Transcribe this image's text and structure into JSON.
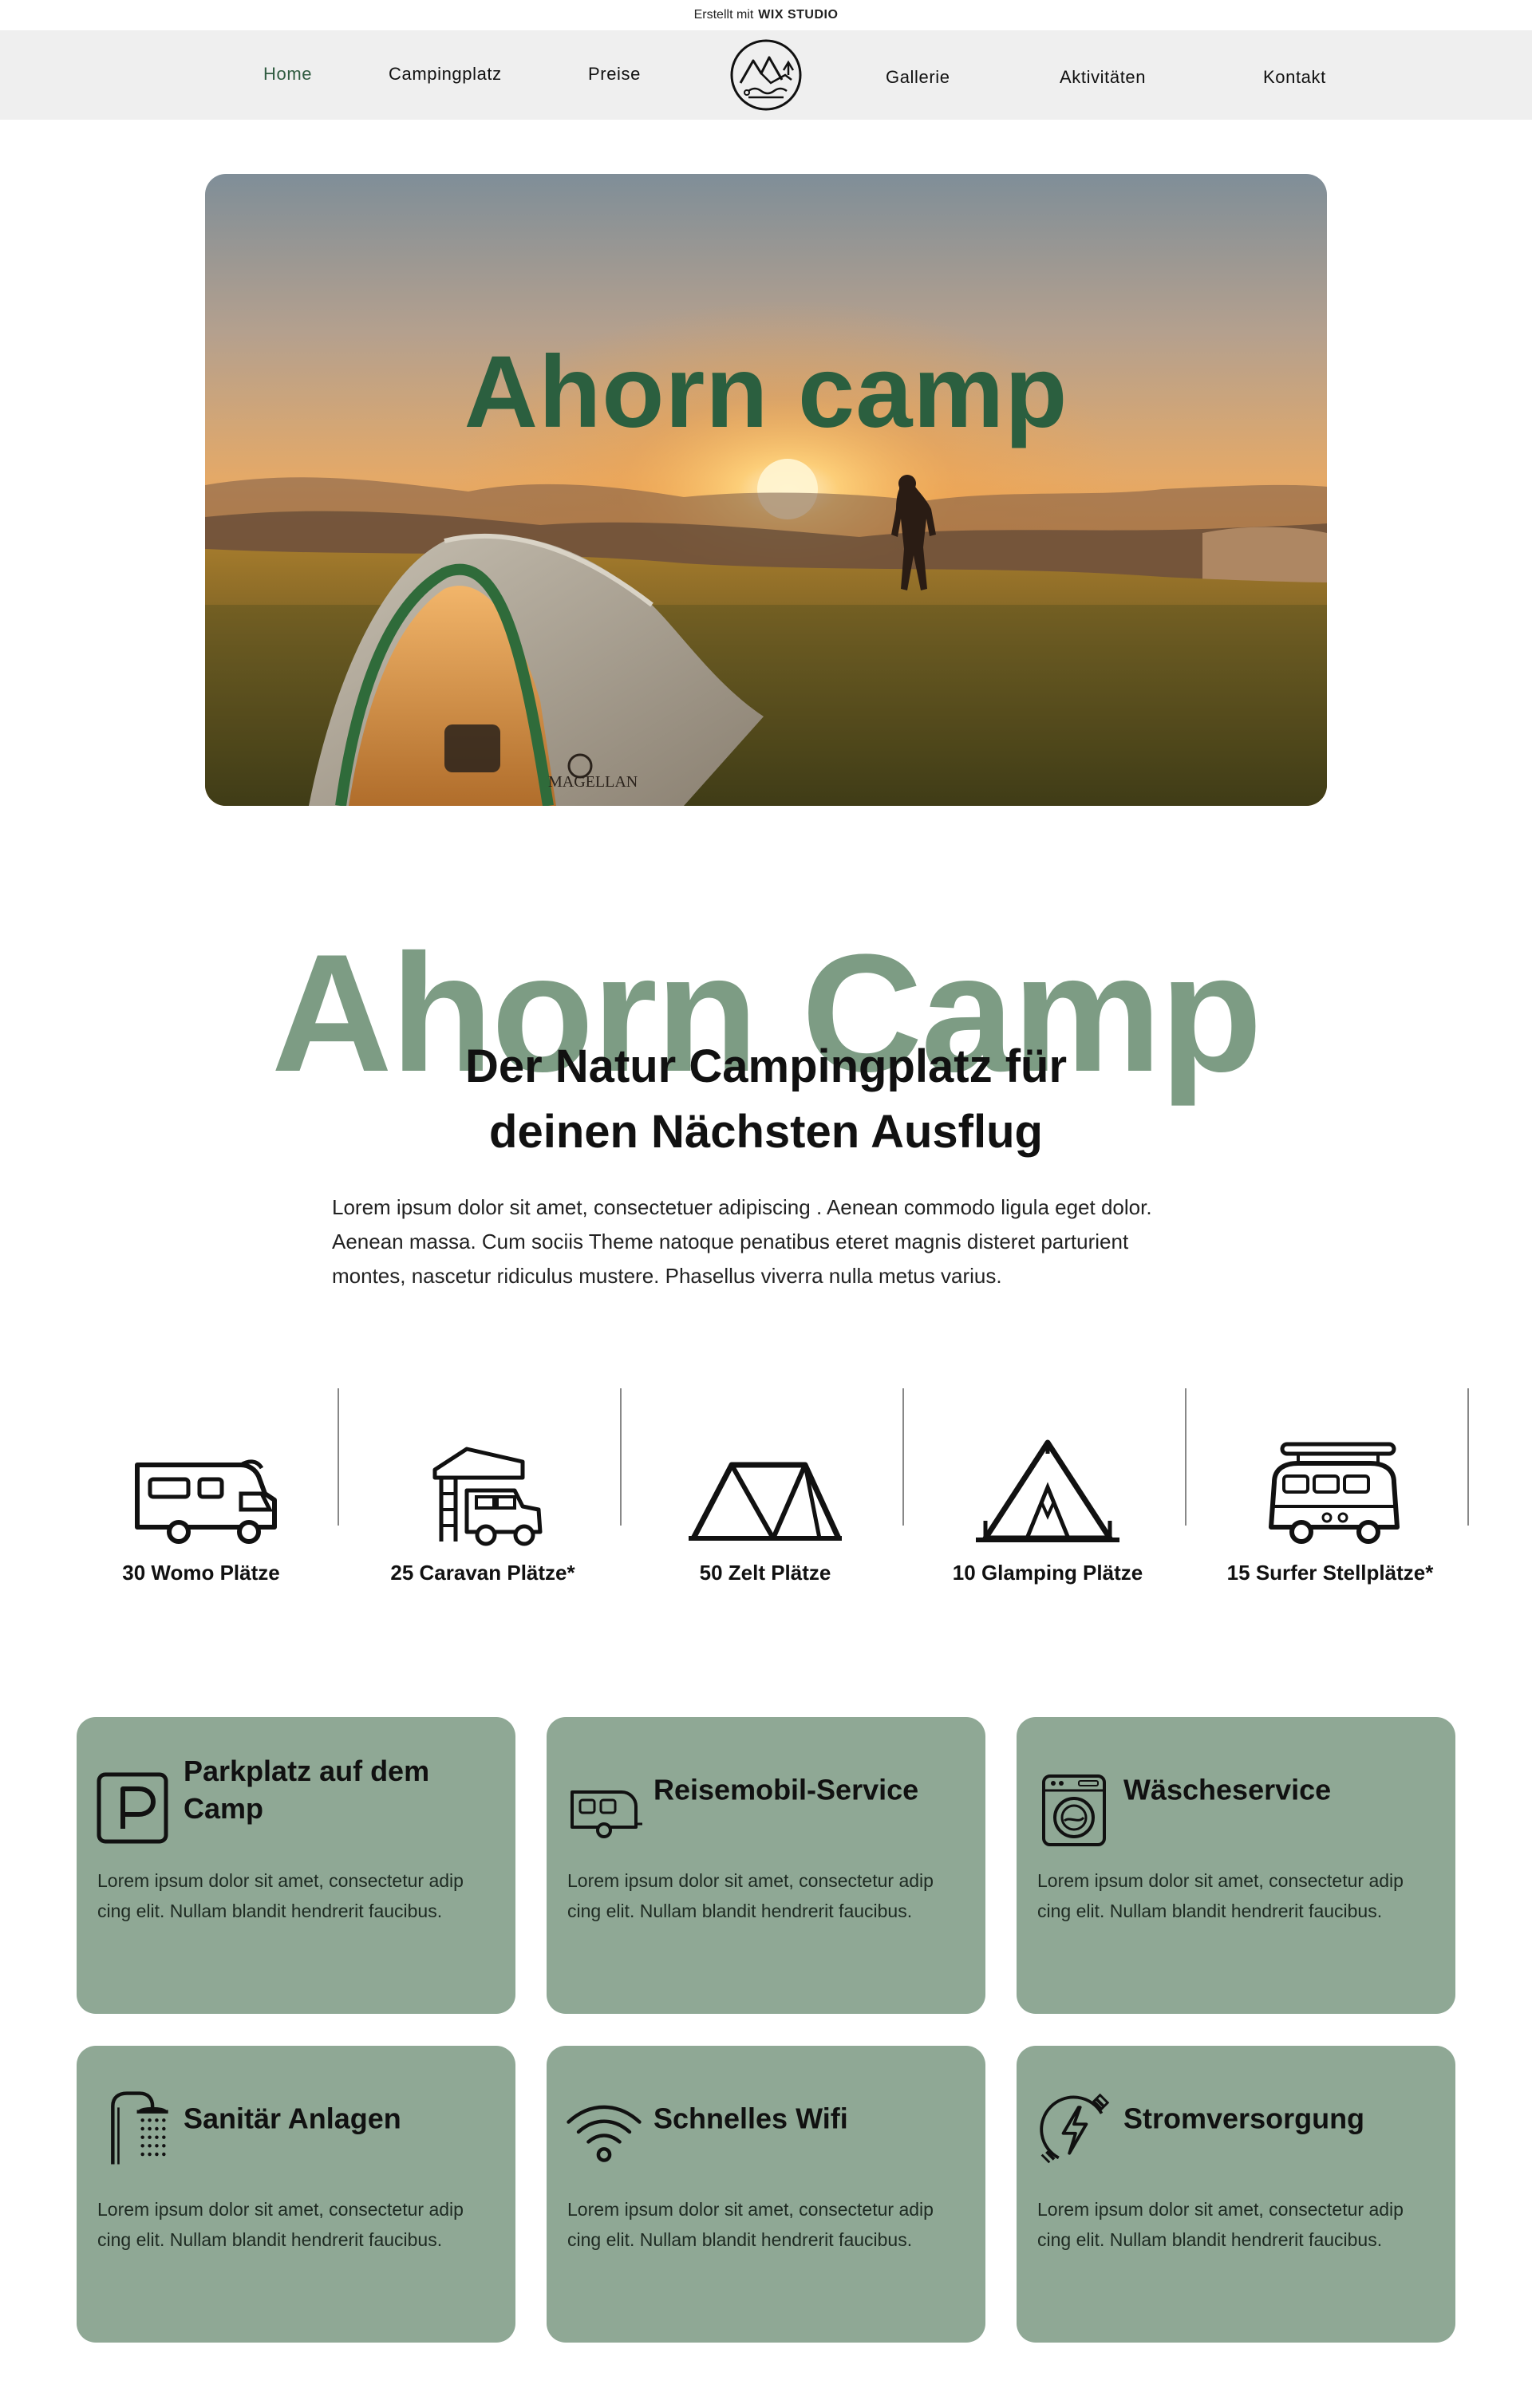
{
  "banner": {
    "prefix": "Erstellt mit",
    "brand": "WIX STUDIO"
  },
  "nav": {
    "items": [
      {
        "label": "Home",
        "active": true
      },
      {
        "label": "Campingplatz"
      },
      {
        "label": "Preise"
      },
      {
        "label": "Gallerie"
      },
      {
        "label": "Aktivitäten"
      },
      {
        "label": "Kontakt"
      }
    ],
    "logo_icon": "mountain-camp-logo-icon"
  },
  "hero": {
    "title": "Ahorn camp",
    "tent_brand": "MAGELLAN",
    "title_color": "#2b5f3f"
  },
  "intro": {
    "watermark": "Ahorn Camp",
    "heading_line1": "Der Natur Campingplatz für",
    "heading_line2": "deinen Nächsten Ausflug",
    "text": "Lorem ipsum dolor sit amet, consectetuer adipiscing . Aenean commodo ligula eget dolor. Aenean massa. Cum sociis Theme natoque penatibus eteret magnis disteret parturient montes, nascetur ridiculus mustere. Phasellus viverra nulla metus varius."
  },
  "capacity": [
    {
      "label": "30 Womo Plätze",
      "icon": "motorhome-icon"
    },
    {
      "label": "25 Caravan Plätze*",
      "icon": "caravan-rooftop-tent-icon"
    },
    {
      "label": "50 Zelt Plätze",
      "icon": "tent-icon"
    },
    {
      "label": "10 Glamping Plätze",
      "icon": "glamping-tent-icon"
    },
    {
      "label": "15 Surfer Stellplätze*",
      "icon": "surf-van-icon"
    }
  ],
  "services": [
    {
      "title": "Parkplatz auf dem Camp",
      "icon": "parking-icon",
      "text": "Lorem ipsum dolor sit amet, consectetur adip cing elit. Nullam blandit hendrerit faucibus."
    },
    {
      "title": "Reisemobil-Service",
      "icon": "rv-service-icon",
      "text": "Lorem ipsum dolor sit amet, consectetur adip cing elit. Nullam blandit hendrerit faucibus."
    },
    {
      "title": "Wäscheservice",
      "icon": "washing-machine-icon",
      "text": "Lorem ipsum dolor sit amet, consectetur adip cing elit. Nullam blandit hendrerit faucibus."
    },
    {
      "title": "Sanitär Anlagen",
      "icon": "shower-icon",
      "text": "Lorem ipsum dolor sit amet, consectetur adip cing elit. Nullam blandit hendrerit faucibus."
    },
    {
      "title": "Schnelles Wifi",
      "icon": "wifi-icon",
      "text": "Lorem ipsum dolor sit amet, consectetur adip cing elit. Nullam blandit hendrerit faucibus."
    },
    {
      "title": "Stromversorgung",
      "icon": "power-plug-icon",
      "text": "Lorem ipsum dolor sit amet, consectetur adip cing elit. Nullam blandit hendrerit faucibus."
    }
  ],
  "colors": {
    "accent_green": "#2b5f3f",
    "sage": "#8fa895",
    "watermark": "#7d9c84",
    "nav_bg": "#efefef"
  }
}
